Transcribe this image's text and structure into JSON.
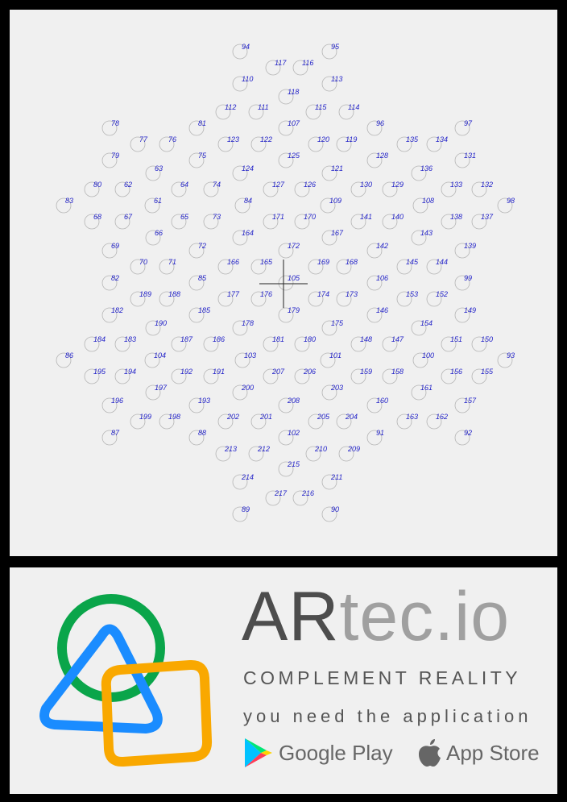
{
  "marker_labels": [
    "94",
    "95",
    "117",
    "116",
    "110",
    "113",
    "118",
    "112",
    "111",
    "115",
    "114",
    "78",
    "81",
    "107",
    "96",
    "97",
    "77",
    "76",
    "123",
    "122",
    "120",
    "119",
    "135",
    "134",
    "79",
    "75",
    "125",
    "128",
    "131",
    "63",
    "124",
    "121",
    "136",
    "80",
    "62",
    "64",
    "74",
    "127",
    "126",
    "130",
    "129",
    "133",
    "132",
    "83",
    "61",
    "84",
    "109",
    "108",
    "98",
    "68",
    "67",
    "65",
    "73",
    "171",
    "170",
    "141",
    "140",
    "138",
    "137",
    "66",
    "164",
    "167",
    "143",
    "69",
    "72",
    "172",
    "142",
    "139",
    "70",
    "71",
    "166",
    "165",
    "169",
    "168",
    "145",
    "144",
    "82",
    "85",
    "105",
    "106",
    "99",
    "189",
    "188",
    "177",
    "176",
    "174",
    "173",
    "153",
    "152",
    "182",
    "185",
    "179",
    "146",
    "149",
    "190",
    "178",
    "175",
    "154",
    "184",
    "183",
    "187",
    "186",
    "181",
    "180",
    "148",
    "147",
    "151",
    "150",
    "86",
    "104",
    "103",
    "101",
    "100",
    "93",
    "195",
    "194",
    "192",
    "191",
    "207",
    "206",
    "159",
    "158",
    "156",
    "155",
    "197",
    "200",
    "203",
    "161",
    "196",
    "193",
    "208",
    "160",
    "157",
    "199",
    "198",
    "202",
    "201",
    "205",
    "204",
    "163",
    "162",
    "87",
    "88",
    "102",
    "91",
    "92",
    "213",
    "212",
    "210",
    "209",
    "215",
    "214",
    "211",
    "217",
    "216",
    "89",
    "90"
  ],
  "brand": {
    "name_dark": "AR",
    "name_light": "tec.io",
    "tagline": "COMPLEMENT REALITY",
    "need_text": "you need the application",
    "google_play": "Google Play",
    "app_store": "App Store"
  },
  "colors": {
    "logo_green": "#0aa54a",
    "logo_blue": "#1a8cff",
    "logo_orange": "#f9a800",
    "marker_label": "#2323c8"
  }
}
